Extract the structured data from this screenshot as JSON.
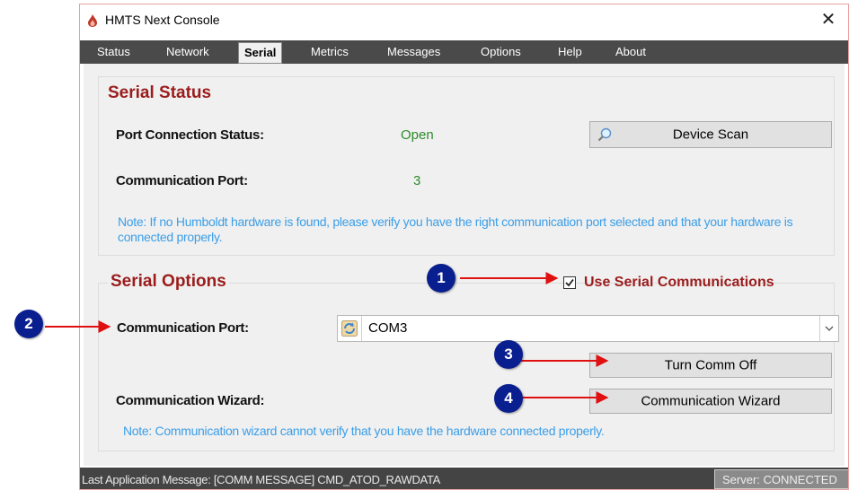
{
  "window": {
    "title": "HMTS Next Console",
    "close_label": "✕"
  },
  "tabs": [
    {
      "label": "Status"
    },
    {
      "label": "Network"
    },
    {
      "label": "Serial",
      "active": true
    },
    {
      "label": "Metrics"
    },
    {
      "label": "Messages"
    },
    {
      "label": "Options"
    },
    {
      "label": "Help"
    },
    {
      "label": "About"
    }
  ],
  "serial_status": {
    "title": "Serial Status",
    "port_connection_label": "Port Connection Status:",
    "port_connection_value": "Open",
    "comm_port_label": "Communication Port:",
    "comm_port_value": "3",
    "device_scan_label": "Device Scan",
    "note": "Note:  If no Humboldt hardware is found, please verify you have the right communication port selected and that your hardware is connected properly."
  },
  "serial_options": {
    "title": "Serial Options",
    "use_serial_label": "Use Serial Communications",
    "use_serial_checked": true,
    "comm_port_label": "Communication Port:",
    "comm_port_selected": "COM3",
    "turn_comm_off_label": "Turn Comm Off",
    "wizard_label": "Communication Wizard:",
    "wizard_button_label": "Communication Wizard",
    "note": "Note:  Communication wizard cannot verify that you have the hardware connected properly."
  },
  "status_bar": {
    "message": "Last Application Message:  [COMM MESSAGE] CMD_ATOD_RAWDATA",
    "server": "Server:  CONNECTED"
  },
  "callouts": [
    "1",
    "2",
    "3",
    "4"
  ],
  "colors": {
    "section_title": "#9b1c1c",
    "value_green": "#2e8b2e",
    "note_blue": "#3b9ee8",
    "callout_blue": "#0a1f8f",
    "arrow_red": "#e01010"
  },
  "icons": {
    "app": "flame-icon",
    "device_scan": "magnifier-icon",
    "combo": "refresh-icon",
    "dropdown": "chevron-down-icon"
  }
}
